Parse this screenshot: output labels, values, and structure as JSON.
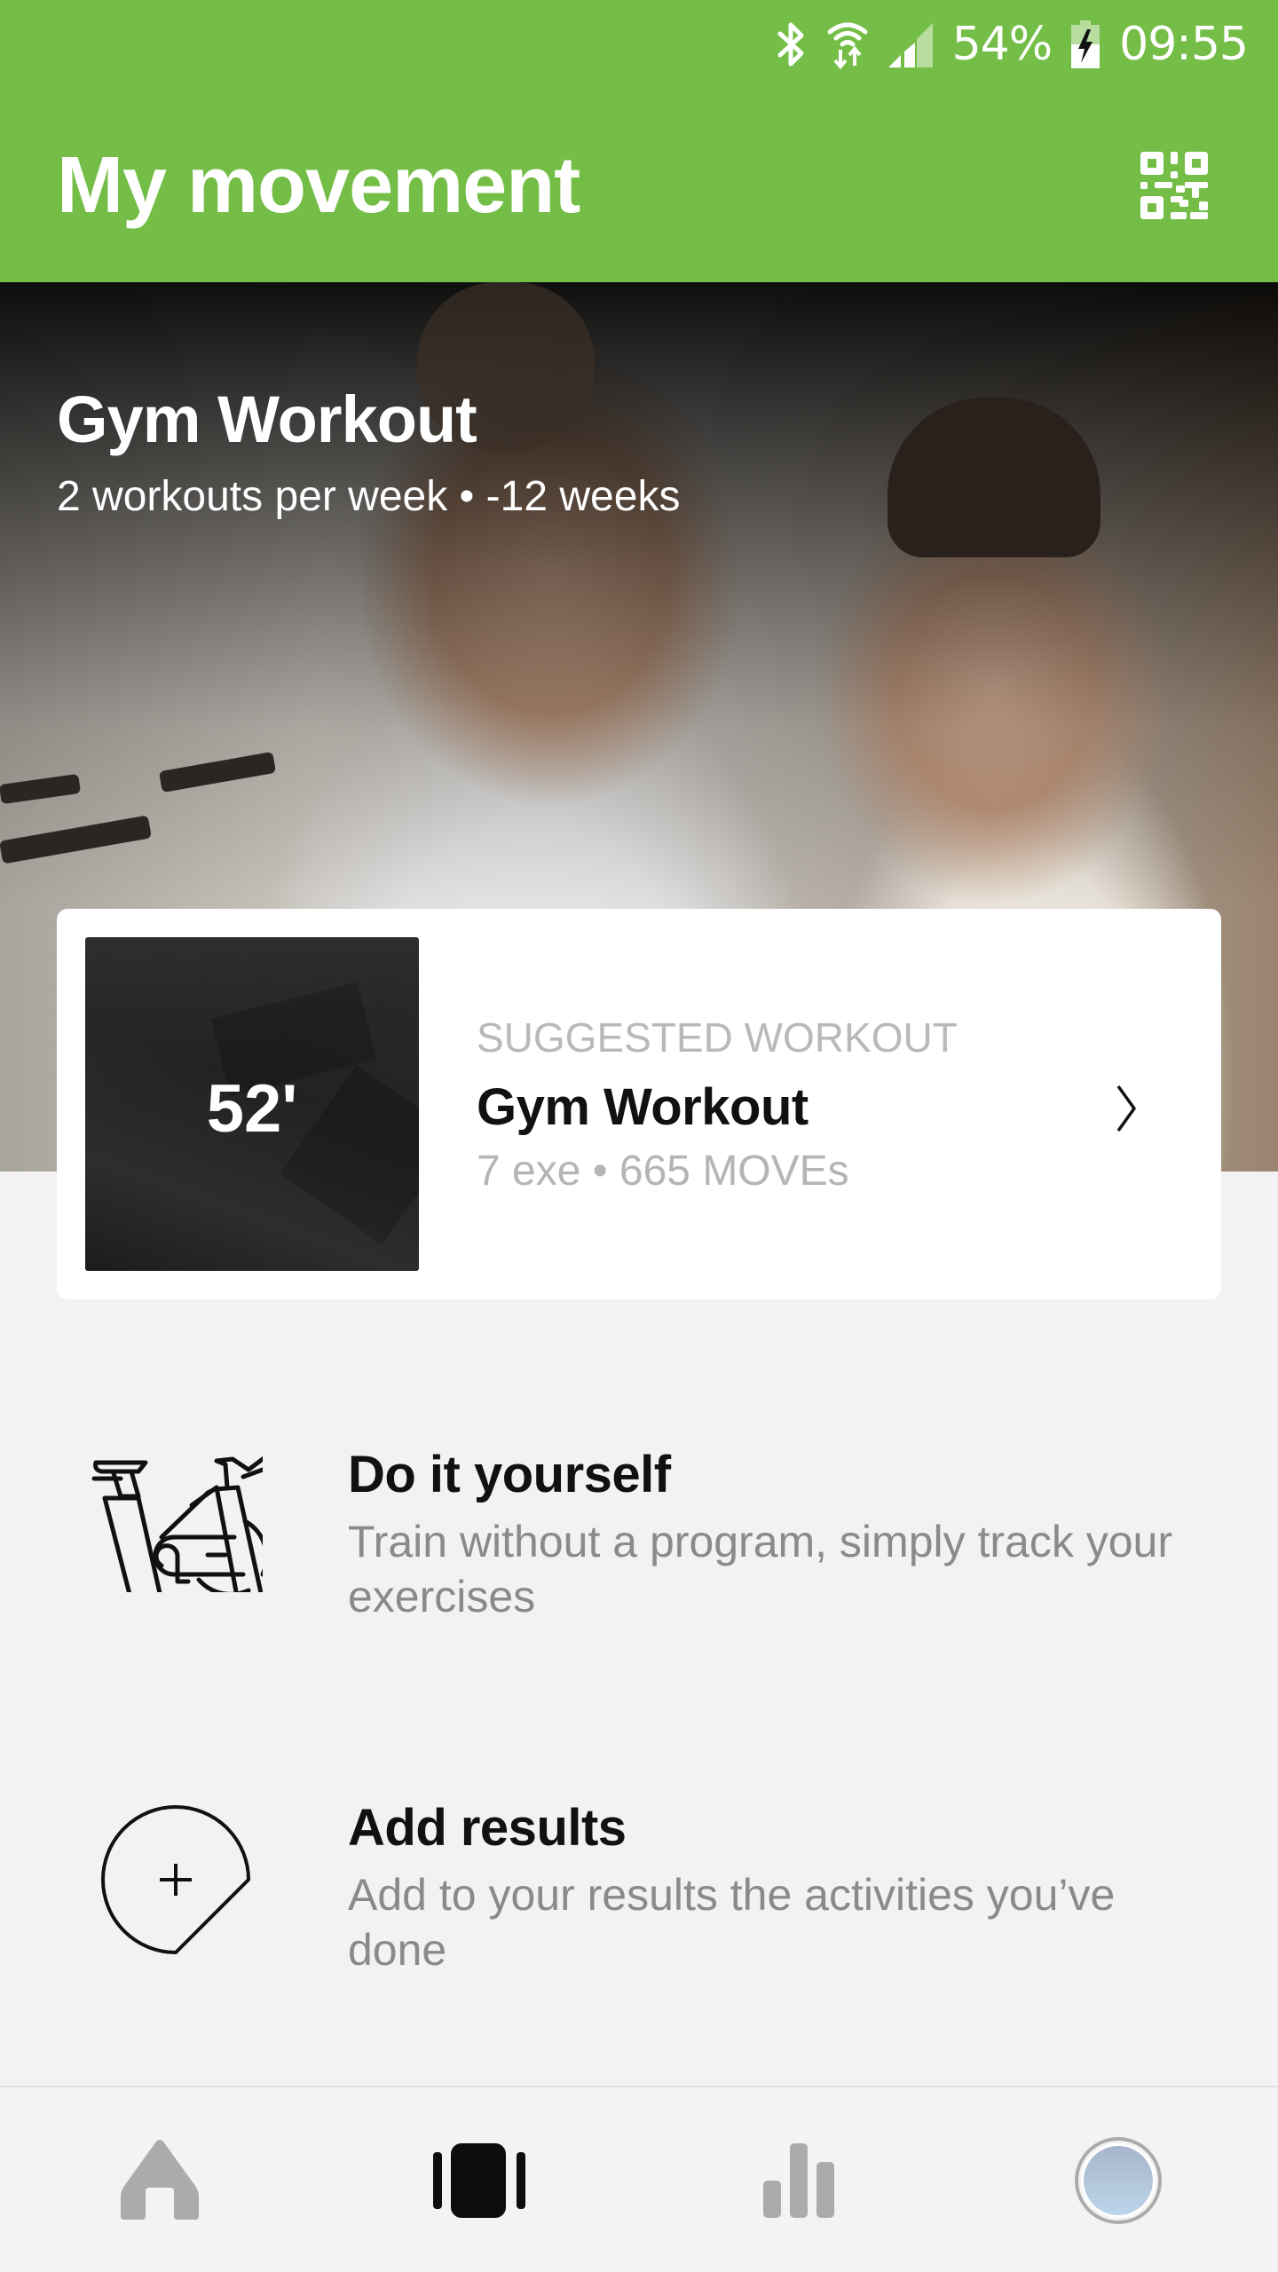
{
  "status_bar": {
    "icons": [
      "bluetooth-icon",
      "wifi-icon",
      "signal-icon",
      "battery-charging-icon"
    ],
    "battery_percent": "54%",
    "time": "09:55"
  },
  "app_bar": {
    "title": "My movement",
    "action_icon": "qr-code-icon",
    "background_color": "#74BE47"
  },
  "hero": {
    "title": "Gym Workout",
    "subtitle": "2 workouts per week • -12 weeks"
  },
  "suggested_card": {
    "duration": "52'",
    "kicker": "SUGGESTED WORKOUT",
    "title": "Gym Workout",
    "meta": "7 exe • 665 MOVEs",
    "chevron_icon": "chevron-right-icon"
  },
  "options": [
    {
      "icon": "exercise-bike-icon",
      "title": "Do it yourself",
      "description": "Train without a program, simply track your exercises"
    },
    {
      "icon": "add-result-icon",
      "title": "Add results",
      "description": "Add to your results the activities you’ve done"
    }
  ],
  "bottom_nav": {
    "items": [
      {
        "name": "home",
        "icon": "home-icon",
        "active": false
      },
      {
        "name": "workouts",
        "icon": "workouts-cards-icon",
        "active": true
      },
      {
        "name": "stats",
        "icon": "bar-chart-icon",
        "active": false
      },
      {
        "name": "profile",
        "icon": "avatar-icon",
        "active": false
      }
    ]
  }
}
